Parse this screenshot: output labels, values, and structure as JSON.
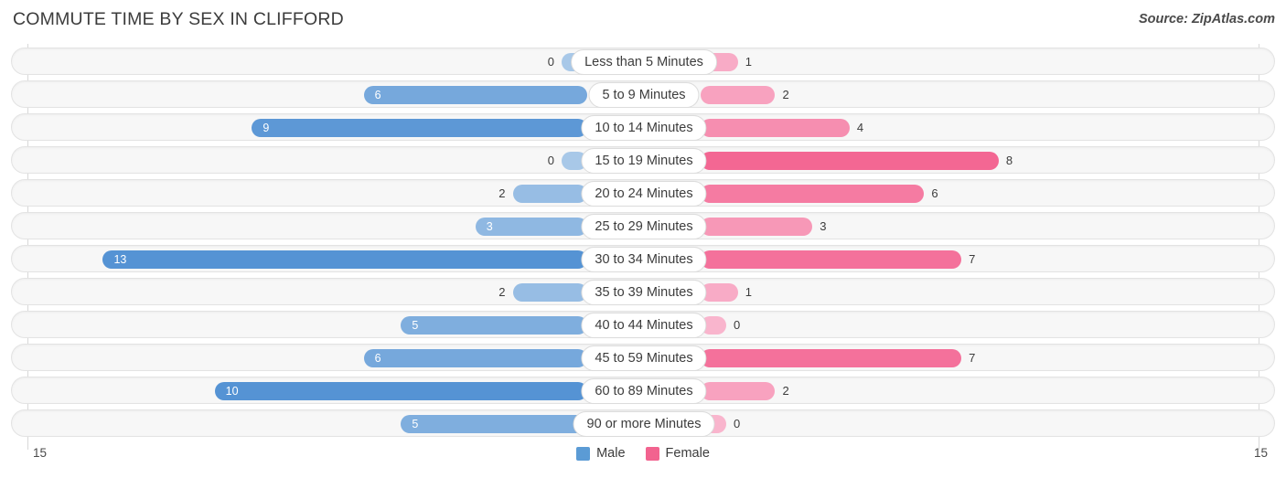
{
  "header": {
    "title": "COMMUTE TIME BY SEX IN CLIFFORD",
    "source": "Source: ZipAtlas.com"
  },
  "legend": {
    "male_label": "Male",
    "female_label": "Female",
    "male_color": "#5b9bd5",
    "female_color": "#f2638f"
  },
  "axis": {
    "left_max_label": "15",
    "right_max_label": "15"
  },
  "chart_data": {
    "type": "bar",
    "orientation": "horizontal-diverging",
    "title": "COMMUTE TIME BY SEX IN CLIFFORD",
    "xlabel": "",
    "ylabel": "",
    "xlim": [
      15,
      15
    ],
    "grid": true,
    "legend_position": "bottom-center",
    "categories": [
      "Less than 5 Minutes",
      "5 to 9 Minutes",
      "10 to 14 Minutes",
      "15 to 19 Minutes",
      "20 to 24 Minutes",
      "25 to 29 Minutes",
      "30 to 34 Minutes",
      "35 to 39 Minutes",
      "40 to 44 Minutes",
      "45 to 59 Minutes",
      "60 to 89 Minutes",
      "90 or more Minutes"
    ],
    "series": [
      {
        "name": "Male",
        "color": "#5b9bd5",
        "values": [
          0,
          6,
          9,
          0,
          2,
          3,
          13,
          2,
          5,
          6,
          10,
          5
        ]
      },
      {
        "name": "Female",
        "color": "#f2638f",
        "values": [
          1,
          2,
          4,
          8,
          6,
          3,
          7,
          1,
          0,
          7,
          2,
          0
        ]
      }
    ]
  },
  "rows": [
    {
      "label": "Less than 5 Minutes",
      "male": 0,
      "female": 1,
      "male_text": "0",
      "female_text": "1"
    },
    {
      "label": "5 to 9 Minutes",
      "male": 6,
      "female": 2,
      "male_text": "6",
      "female_text": "2"
    },
    {
      "label": "10 to 14 Minutes",
      "male": 9,
      "female": 4,
      "male_text": "9",
      "female_text": "4"
    },
    {
      "label": "15 to 19 Minutes",
      "male": 0,
      "female": 8,
      "male_text": "0",
      "female_text": "8"
    },
    {
      "label": "20 to 24 Minutes",
      "male": 2,
      "female": 6,
      "male_text": "2",
      "female_text": "6"
    },
    {
      "label": "25 to 29 Minutes",
      "male": 3,
      "female": 3,
      "male_text": "3",
      "female_text": "3"
    },
    {
      "label": "30 to 34 Minutes",
      "male": 13,
      "female": 7,
      "male_text": "13",
      "female_text": "7"
    },
    {
      "label": "35 to 39 Minutes",
      "male": 2,
      "female": 1,
      "male_text": "2",
      "female_text": "1"
    },
    {
      "label": "40 to 44 Minutes",
      "male": 5,
      "female": 0,
      "male_text": "5",
      "female_text": "0"
    },
    {
      "label": "45 to 59 Minutes",
      "male": 6,
      "female": 7,
      "male_text": "6",
      "female_text": "7"
    },
    {
      "label": "60 to 89 Minutes",
      "male": 10,
      "female": 2,
      "male_text": "10",
      "female_text": "2"
    },
    {
      "label": "90 or more Minutes",
      "male": 5,
      "female": 0,
      "male_text": "5",
      "female_text": "0"
    }
  ]
}
